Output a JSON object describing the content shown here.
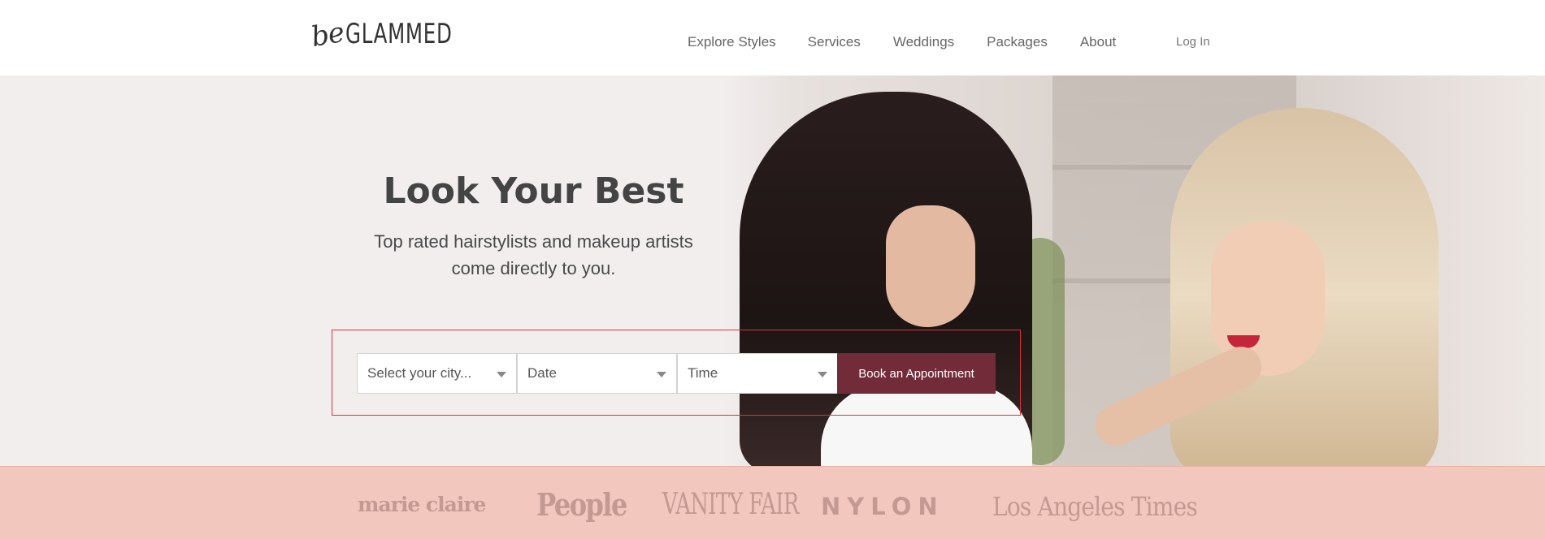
{
  "brand": {
    "prefix": "be",
    "name": "GLAMMED"
  },
  "nav": {
    "items": [
      "Explore Styles",
      "Services",
      "Weddings",
      "Packages",
      "About"
    ],
    "login": "Log In"
  },
  "hero": {
    "title": "Look Your Best",
    "subtitle_line1": "Top rated hairstylists and makeup artists",
    "subtitle_line2": "come directly to you."
  },
  "booking": {
    "city_placeholder": "Select your city...",
    "date_placeholder": "Date",
    "time_placeholder": "Time",
    "button_label": "Book an Appointment"
  },
  "press": [
    "marie claire",
    "People",
    "VANITY FAIR",
    "NYLON",
    "Los Angeles Times"
  ],
  "colors": {
    "accent": "#722b38",
    "hero_bg": "#f2eeee",
    "press_bg": "#f2c7bd",
    "press_text": "#c39a92",
    "search_outline": "#d9323a"
  }
}
